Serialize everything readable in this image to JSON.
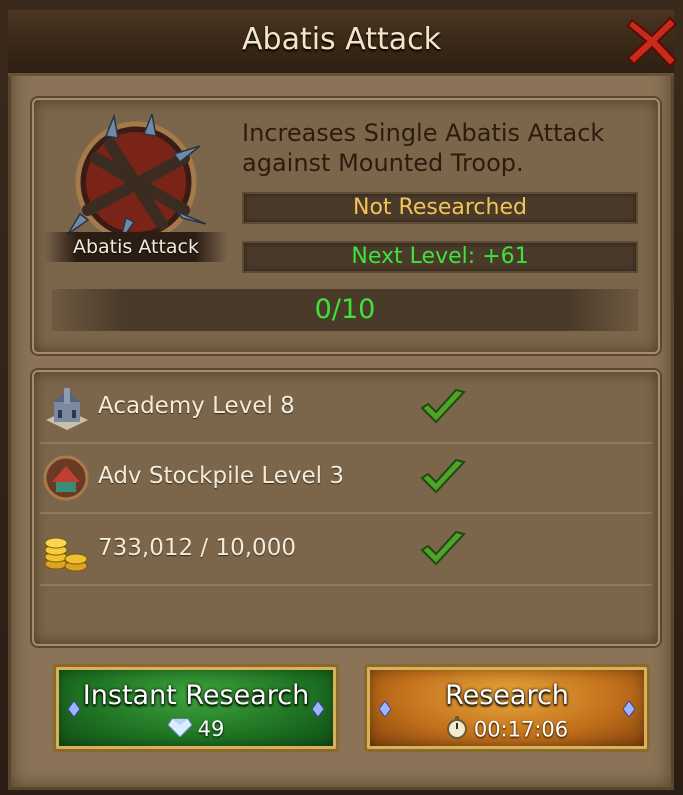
{
  "dialog": {
    "title": "Abatis Attack",
    "close_icon": "close-icon"
  },
  "research": {
    "icon_label": "Abatis Attack",
    "description": "Increases Single Abatis Attack against Mounted Troop.",
    "status": "Not Researched",
    "next_level": "Next Level: +61",
    "progress_text": "0/10",
    "progress_fraction": 0.0
  },
  "requirements": [
    {
      "icon": "academy-icon",
      "label": "Academy Level 8",
      "met": true
    },
    {
      "icon": "stockpile-icon",
      "label": "Adv Stockpile Level 3",
      "met": true
    },
    {
      "icon": "gold-icon",
      "label": "733,012 / 10,000",
      "met": true
    }
  ],
  "buttons": {
    "instant_label": "Instant Research",
    "instant_cost": "49",
    "research_label": "Research",
    "research_time": "00:17:06"
  },
  "colors": {
    "status": "#f1c45a",
    "positive": "#3ee23a",
    "instant_button": "#1f7423",
    "research_button": "#c2701b"
  }
}
